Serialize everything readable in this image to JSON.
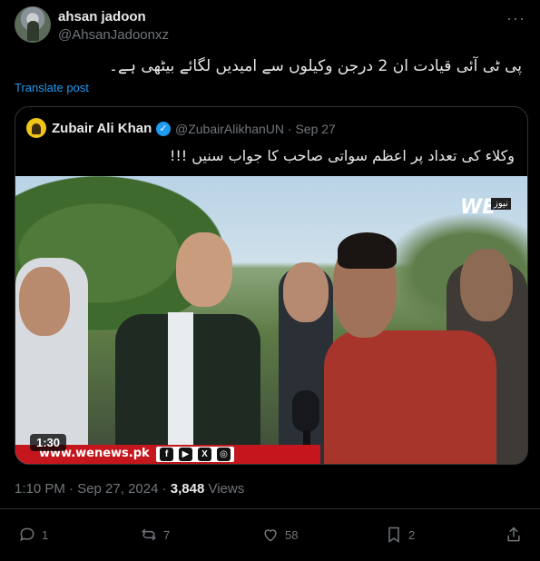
{
  "post": {
    "author_name": "ahsan jadoon",
    "author_handle": "@AhsanJadoonxz",
    "text": "پی ٹی آئی قیادت ان 2 درجن وکیلوں سے امیدیں لگائے بیٹھی ہے۔",
    "translate_label": "Translate post",
    "timestamp": "1:10 PM · Sep 27, 2024 · ",
    "views_count": "3,848",
    "views_label": " Views"
  },
  "quoted": {
    "author_name": "Zubair Ali Khan",
    "handle_date": "@ZubairAlikhanUN · Sep 27",
    "text": "وکلاء کی تعداد پر اعظم سواتی صاحب کا جواب سنیں !!!",
    "video": {
      "duration": "1:30",
      "ticker_url": "www.wenews.pk",
      "logo_text": "WE",
      "logo_badge": "نیوز"
    }
  },
  "actions": {
    "replies": "1",
    "reposts": "7",
    "likes": "58",
    "bookmarks": "2"
  },
  "icons": {
    "more": "more-horizontal-icon",
    "verified": "verified-badge-icon",
    "reply": "reply-icon",
    "repost": "repost-icon",
    "like": "heart-icon",
    "bookmark": "bookmark-icon",
    "share": "share-icon"
  },
  "colors": {
    "background": "#000000",
    "text": "#e7e9ea",
    "secondary": "#71767b",
    "accent": "#1d9bf0",
    "border": "#2f3336",
    "ticker": "#c4161c"
  }
}
